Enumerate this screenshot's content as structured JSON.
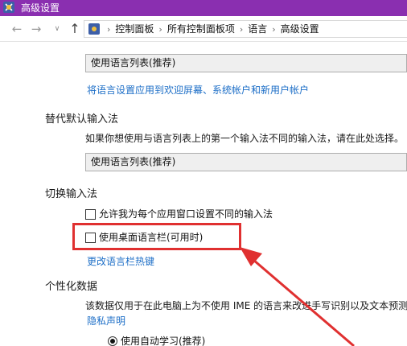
{
  "window": {
    "title": "高级设置"
  },
  "nav": {
    "back_glyph": "←",
    "forward_glyph": "→",
    "dropdown_glyph": "∨",
    "up_glyph": "↑"
  },
  "address": {
    "separator": "›",
    "crumbs": [
      "控制面板",
      "所有控制面板项",
      "语言",
      "高级设置"
    ]
  },
  "sections": {
    "top_dropdown_value": "使用语言列表(推荐)",
    "apply_link": "将语言设置应用到欢迎屏幕、系统帐户和新用户帐户",
    "override_input": {
      "heading": "替代默认输入法",
      "description": "如果你想使用与语言列表上的第一个输入法不同的输入法，请在此处选择。",
      "dropdown_value": "使用语言列表(推荐)"
    },
    "switch_input": {
      "heading": "切换输入法",
      "checkbox_per_app": "允许我为每个应用窗口设置不同的输入法",
      "checkbox_per_app_checked": false,
      "checkbox_language_bar": "使用桌面语言栏(可用时)",
      "checkbox_language_bar_checked": false,
      "hotkeys_link": "更改语言栏热键"
    },
    "personalization": {
      "heading": "个性化数据",
      "description": "该数据仅用于在此电脑上为不使用 IME 的语言来改进手写识别以及文本预测",
      "privacy_link": "隐私声明",
      "radio_auto_learn": "使用自动学习(推荐)",
      "radio_auto_learn_selected": true
    }
  },
  "colors": {
    "titlebar": "#8a2fb0",
    "link": "#1c6ec7",
    "annotation_red": "#e03030"
  }
}
